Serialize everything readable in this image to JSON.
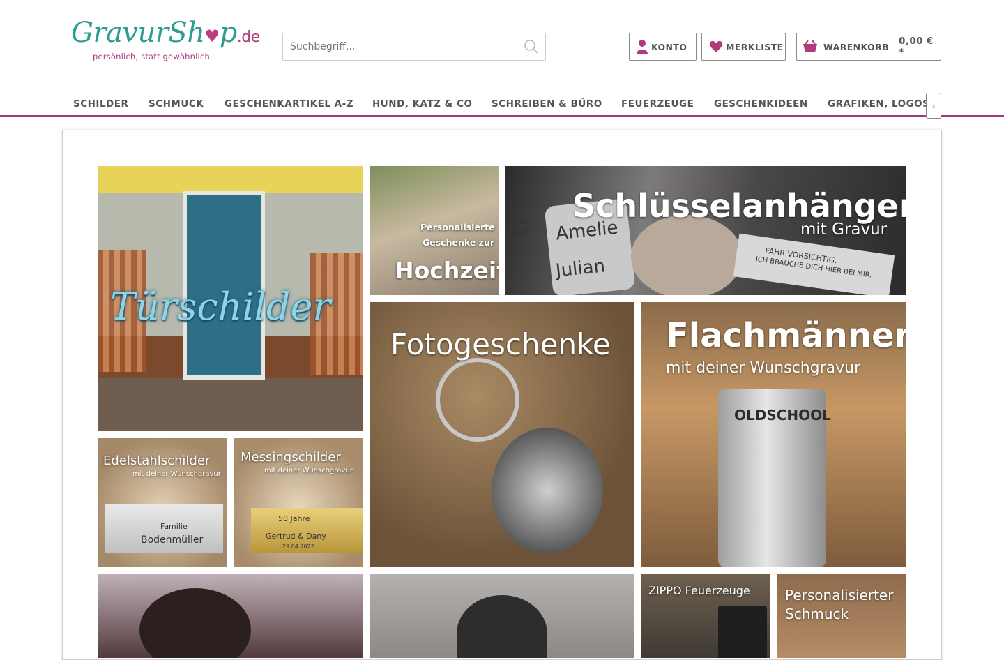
{
  "brand": {
    "name_main": "GravurSh",
    "name_end": "p",
    "domain": ".de",
    "tagline": "persönlich, statt gewöhnlich",
    "teal": "#2f9c93",
    "magenta": "#b23a7c"
  },
  "search": {
    "placeholder": "Suchbegriff...",
    "value": ""
  },
  "header": {
    "account_label": "KONTO",
    "wishlist_label": "MERKLISTE",
    "cart_label": "WARENKORB",
    "cart_price": "0,00 € *"
  },
  "nav": {
    "items": [
      "SCHILDER",
      "SCHMUCK",
      "GESCHENKARTIKEL A-Z",
      "HUND, KATZ & CO",
      "SCHREIBEN & BÜRO",
      "FEUERZEUGE",
      "GESCHENKIDEEN",
      "GRAFIKEN, LOGOS"
    ],
    "accent": "#a4397a"
  },
  "tiles": {
    "tuerschilder": "Türschilder",
    "hochzeit_line1": "Personalisierte",
    "hochzeit_line2": "Geschenke zur",
    "hochzeit_big": "Hochzeit",
    "schluessel_title": "Schlüsselanhänger",
    "schluessel_sub": "mit Gravur",
    "schluessel_tag1": "Amelie",
    "schluessel_tag2": "Julian",
    "schluessel_small": "Lieb Dich",
    "schluessel_plate_line1": "FAHR VORSICHTIG.",
    "schluessel_plate_line2": "ICH BRAUCHE DICH HIER BEI MIR.",
    "foto": "Fotogeschenke",
    "flach_title": "Flachmänner",
    "flach_sub": "mit deiner Wunschgravur",
    "flach_flask": "OLDSCHOOL",
    "edel_title": "Edelstahlschilder",
    "edel_sub": "mit deiner Wunschgravur",
    "edel_plate1": "Familie",
    "edel_plate2": "Bodenmüller",
    "mess_title": "Messingschilder",
    "mess_sub": "mit deiner Wunschgravur",
    "mess_plate1": "50 Jahre",
    "mess_plate2": "Gertrud & Dany",
    "mess_plate3": "29.04.2022",
    "zippo": "ZIPPO Feuerzeuge",
    "schmuck_line1": "Personalisierter",
    "schmuck_line2": "Schmuck"
  }
}
